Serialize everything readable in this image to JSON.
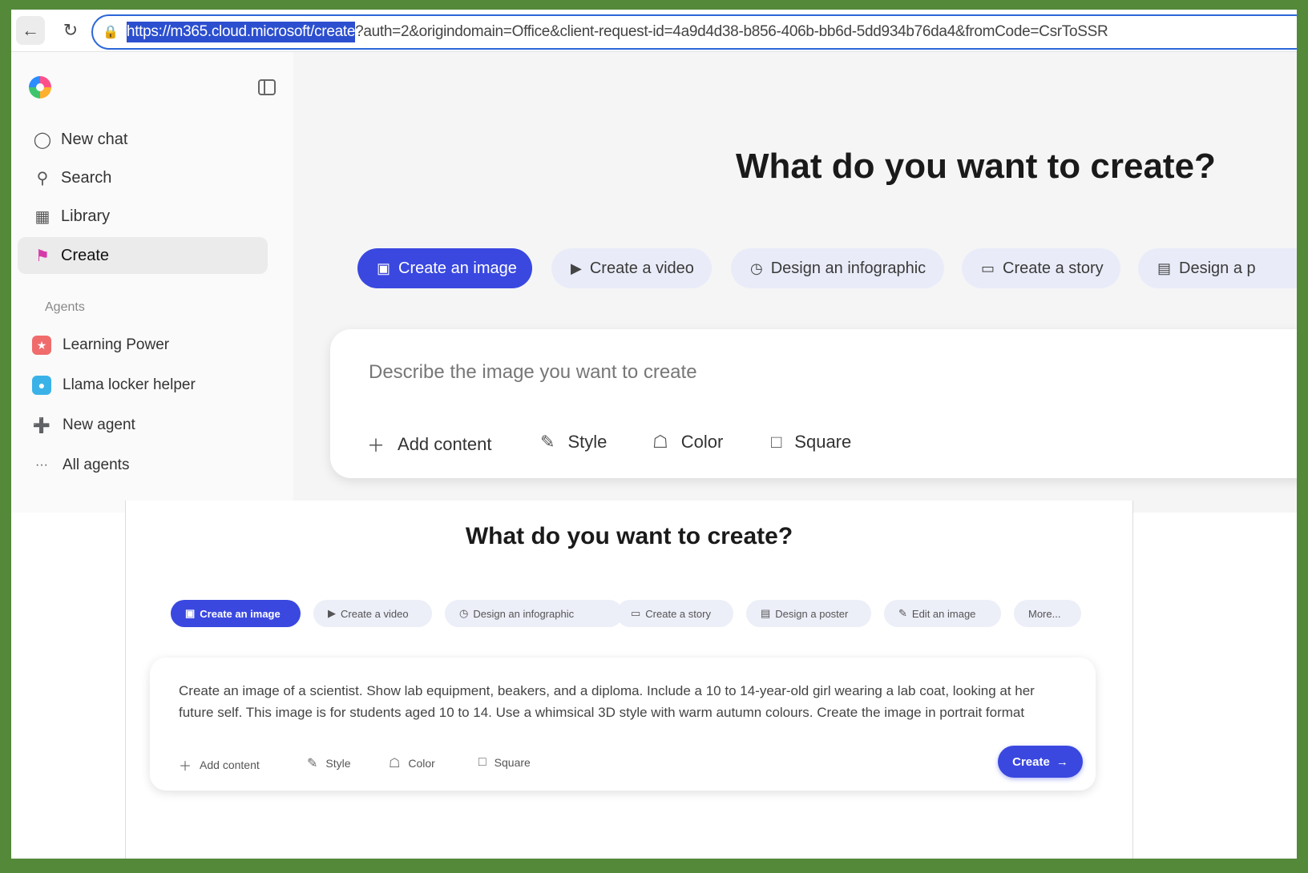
{
  "browser": {
    "url_selected": "https://m365.cloud.microsoft/create",
    "url_rest": "?auth=2&origindomain=Office&client-request-id=4a9d4d38-b856-406b-bb6d-5dd934b76da4&fromCode=CsrToSSR"
  },
  "sidebar": {
    "items": [
      {
        "label": "New chat",
        "icon": "chat-bubble-icon"
      },
      {
        "label": "Search",
        "icon": "search-icon"
      },
      {
        "label": "Library",
        "icon": "library-icon"
      },
      {
        "label": "Create",
        "icon": "create-icon"
      }
    ],
    "agents_label": "Agents",
    "agents": [
      {
        "label": "Learning Power",
        "icon": "learning-power-icon",
        "color": "#f06b6b"
      },
      {
        "label": "Llama locker helper",
        "icon": "llama-icon",
        "color": "#3ab2e8"
      },
      {
        "label": "New agent",
        "icon": "new-agent-icon",
        "color": "#ffffff"
      },
      {
        "label": "All agents",
        "icon": "more-icon",
        "color": "#ffffff"
      }
    ]
  },
  "top": {
    "title": "What do you want to create?",
    "pills": [
      "Create an image",
      "Create a video",
      "Design an infographic",
      "Create a story",
      "Design a p"
    ],
    "prompt_placeholder": "Describe the image you want to create",
    "tools": [
      "Add content",
      "Style",
      "Color",
      "Square"
    ]
  },
  "bottom": {
    "title": "What do you want to create?",
    "pills": [
      "Create an image",
      "Create a video",
      "Design an infographic",
      "Create a story",
      "Design a poster",
      "Edit an image",
      "More..."
    ],
    "prompt_text": "Create an image of a scientist. Show lab equipment, beakers, and a diploma. Include a 10 to 14-year-old girl wearing a lab coat, looking at her future self. This image is for students aged 10 to 14. Use a whimsical 3D style with warm autumn colours. Create the image in portrait format",
    "tools": [
      "Add content",
      "Style",
      "Color",
      "Square"
    ],
    "create_label": "Create"
  },
  "colors": {
    "accent": "#3a48e0",
    "border": "#54893a"
  }
}
